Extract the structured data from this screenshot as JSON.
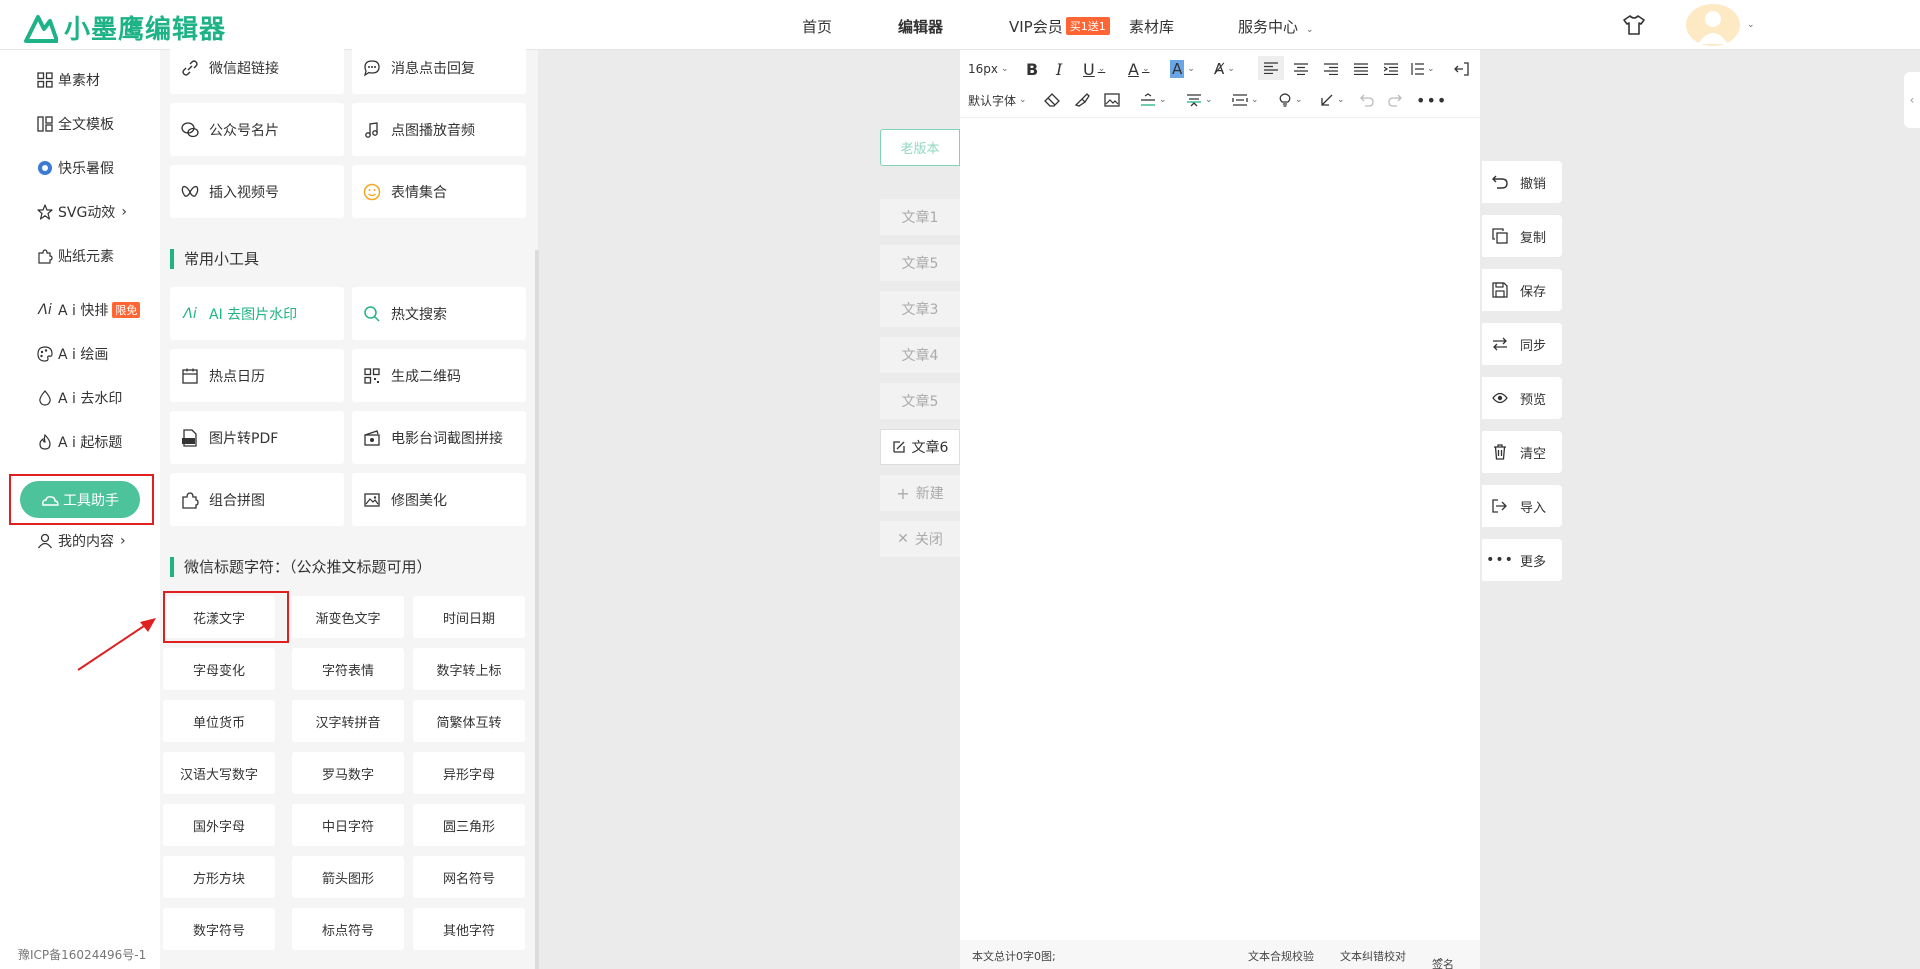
{
  "header": {
    "logo_text": "小墨鹰编辑器",
    "nav": [
      "首页",
      "编辑器",
      "VIP会员",
      "素材库",
      "服务中心"
    ],
    "vip_badge": "买1送1"
  },
  "left_nav": {
    "items": [
      "单素材",
      "全文模板",
      "快乐暑假",
      "SVG动效",
      "贴纸元素",
      "A i 快排",
      "A i 绘画",
      "A i 去水印",
      "A i 起标题",
      "工具助手",
      "我的内容"
    ],
    "free_badge": "限免"
  },
  "tool_panel": {
    "top_cards": [
      "微信超链接",
      "消息点击回复",
      "公众号名片",
      "点图播放音频",
      "插入视频号",
      "表情集合"
    ],
    "section_tools": "常用小工具",
    "tool_cards": [
      "AI 去图片水印",
      "热文搜索",
      "热点日历",
      "生成二维码",
      "图片转PDF",
      "电影台词截图拼接",
      "组合拼图",
      "修图美化"
    ],
    "section_chars": "微信标题字符：（公众推文标题可用）",
    "char_buttons": [
      "花漾文字",
      "渐变色文字",
      "时间日期",
      "字母变化",
      "字符表情",
      "数字转上标",
      "单位货币",
      "汉字转拼音",
      "简繁体互转",
      "汉语大写数字",
      "罗马数字",
      "异形字母",
      "国外字母",
      "中日字符",
      "圆三角形",
      "方形方块",
      "箭头图形",
      "网名符号",
      "数字符号",
      "标点符号",
      "其他字符"
    ]
  },
  "articles": {
    "old_version": "老版本",
    "items": [
      "文章1",
      "文章5",
      "文章3",
      "文章4",
      "文章5",
      "文章6"
    ],
    "new": "新建",
    "close": "关闭"
  },
  "editor": {
    "font_size": "16px",
    "font_family": "默认字体",
    "footer": {
      "count": "本文总计0字0图;",
      "compliance": "文本合规校验",
      "proofread": "文本纠错校对",
      "signature": "签名"
    }
  },
  "actions": [
    "撤销",
    "复制",
    "保存",
    "同步",
    "预览",
    "清空",
    "导入",
    "更多"
  ],
  "icp": "豫ICP备16024496号-1",
  "colors": {
    "brand": "#1eb386",
    "accent_pill": "#4cc39b",
    "badge": "#ff6633",
    "highlight_box": "#e02020"
  }
}
